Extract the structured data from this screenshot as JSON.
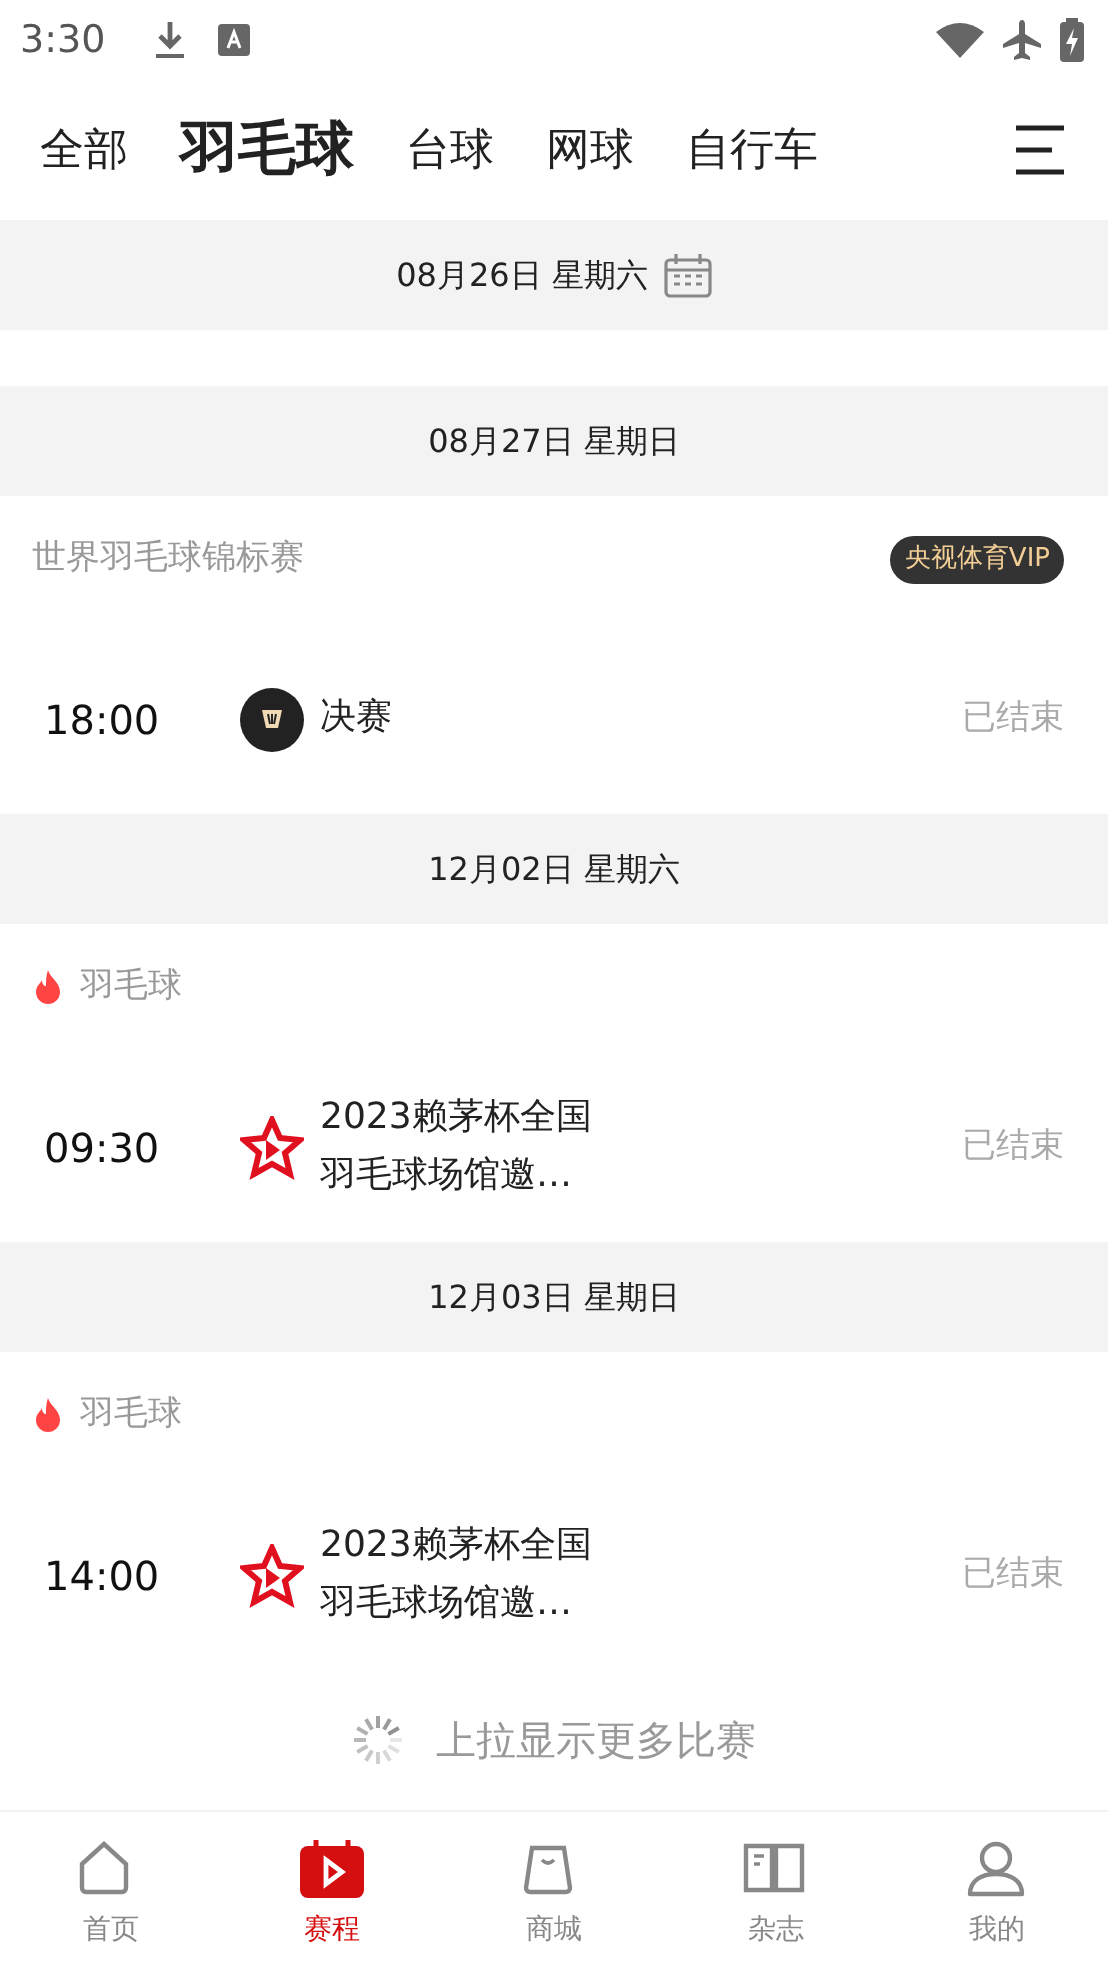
{
  "status_bar": {
    "time": "3:30"
  },
  "tabs": [
    {
      "label": "全部",
      "selected": false
    },
    {
      "label": "羽毛球",
      "selected": true
    },
    {
      "label": "台球",
      "selected": false
    },
    {
      "label": "网球",
      "selected": false
    },
    {
      "label": "自行车",
      "selected": false
    }
  ],
  "days": [
    {
      "date": "08月26日 星期六",
      "kind": "picker"
    },
    {
      "date": "08月27日 星期日",
      "kind": "plain",
      "groups": [
        {
          "league": "世界羽毛球锦标赛",
          "kind": "plain",
          "badge": "央视体育VIP",
          "matches": [
            {
              "time": "18:00",
              "kind": "dark-logo",
              "title": "决赛",
              "status": "已结束"
            }
          ]
        }
      ]
    },
    {
      "date": "12月02日 星期六",
      "kind": "plain",
      "groups": [
        {
          "league": "羽毛球",
          "kind": "hot",
          "matches": [
            {
              "time": "09:30",
              "kind": "star-logo",
              "title": "2023赖茅杯全国羽毛球场馆邀…",
              "status": "已结束"
            }
          ]
        }
      ]
    },
    {
      "date": "12月03日 星期日",
      "kind": "plain",
      "groups": [
        {
          "league": "羽毛球",
          "kind": "hot",
          "matches": [
            {
              "time": "14:00",
              "kind": "star-logo",
              "title": "2023赖茅杯全国羽毛球场馆邀…",
              "status": "已结束"
            }
          ]
        }
      ]
    }
  ],
  "load_more": "上拉显示更多比赛",
  "bottom_nav": [
    {
      "label": "首页",
      "kind": "home",
      "selected": false
    },
    {
      "label": "赛程",
      "kind": "schedule",
      "selected": true
    },
    {
      "label": "商城",
      "kind": "shop",
      "selected": false
    },
    {
      "label": "杂志",
      "kind": "magazine",
      "selected": false
    },
    {
      "label": "我的",
      "kind": "profile",
      "selected": false
    }
  ]
}
